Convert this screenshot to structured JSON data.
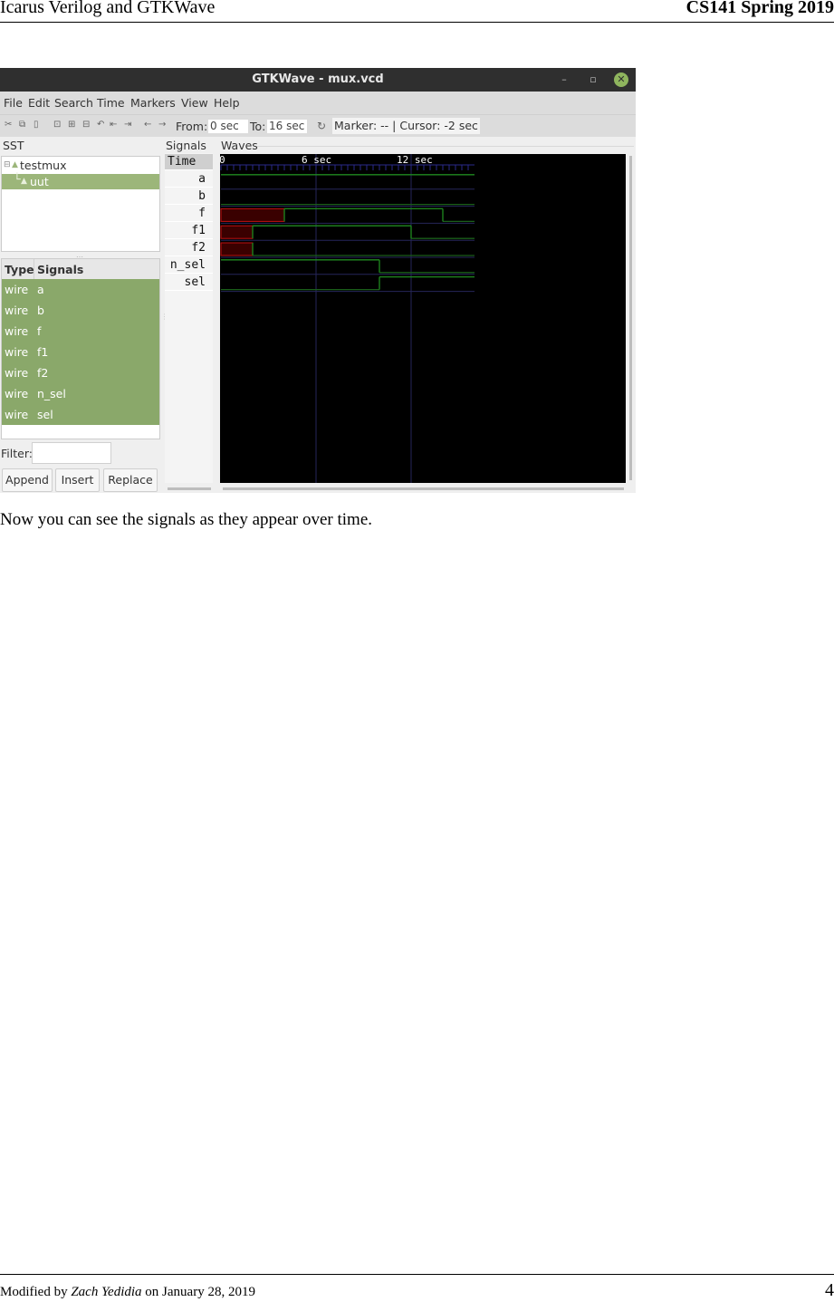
{
  "page": {
    "header_left": "Icarus Verilog and GTKWave",
    "header_right": "CS141 Spring 2019",
    "caption": "Now you can see the signals as they appear over time.",
    "footer_prefix": "Modified by ",
    "footer_author": "Zach Yedidia",
    "footer_suffix": " on January 28, 2019",
    "page_number": "4"
  },
  "window": {
    "title": "GTKWave - mux.vcd",
    "controls": {
      "minimize": "–",
      "maximize": "▫",
      "close": "✕"
    },
    "menu": [
      "File",
      "Edit",
      "Search",
      "Time",
      "Markers",
      "View",
      "Help"
    ],
    "toolbar": {
      "icons": [
        "cut-icon",
        "copy-icon",
        "paste-icon",
        "zoom-fit-icon",
        "zoom-in-icon",
        "zoom-out-icon",
        "undo-zoom-icon",
        "zoom-start-icon",
        "zoom-end-icon",
        "prev-icon",
        "next-icon"
      ],
      "icon_glyphs": [
        "✂",
        "⧉",
        "▯",
        "⊡",
        "⊞",
        "⊟",
        "↶",
        "⇤",
        "⇥",
        "←",
        "→"
      ],
      "from_label": "From:",
      "from_value": "0 sec",
      "to_label": "To:",
      "to_value": "16 sec",
      "reload_glyph": "↻",
      "marker_status": "Marker: --  |  Cursor: -2 sec"
    },
    "sst": {
      "label": "SST",
      "tree": [
        {
          "label": "testmux",
          "expander": "⊟",
          "selected": false
        },
        {
          "label": "uut",
          "selected": true
        }
      ],
      "columns": [
        "Type",
        "Signals"
      ],
      "signals": [
        {
          "type": "wire",
          "name": "a"
        },
        {
          "type": "wire",
          "name": "b"
        },
        {
          "type": "wire",
          "name": "f"
        },
        {
          "type": "wire",
          "name": "f1"
        },
        {
          "type": "wire",
          "name": "f2"
        },
        {
          "type": "wire",
          "name": "n_sel"
        },
        {
          "type": "wire",
          "name": "sel"
        }
      ],
      "filter_label": "Filter:",
      "filter_value": "",
      "buttons": [
        "Append",
        "Insert",
        "Replace"
      ]
    },
    "signals_pane": {
      "label": "Signals",
      "names": [
        "Time",
        "a",
        "b",
        "f",
        "f1",
        "f2",
        "n_sel",
        "sel"
      ]
    },
    "waves_pane": {
      "label": "Waves",
      "time_range_sec": [
        0,
        16
      ],
      "visible_end_sec": 16,
      "tick_labels": [
        {
          "t": 0,
          "label": "0"
        },
        {
          "t": 6,
          "label": "6 sec"
        },
        {
          "t": 12,
          "label": "12 sec"
        }
      ],
      "colors": {
        "bg": "#000000",
        "grid": "#26265a",
        "high": "#1f8a1f",
        "low": "#1a5e1a",
        "x_fill": "#3a0000",
        "x_edge": "#c01010",
        "ruler": "#2a2a8a",
        "text": "#ffffff"
      },
      "traces": [
        {
          "name": "a",
          "segments": [
            {
              "from": 0,
              "to": 16,
              "value": "1"
            }
          ]
        },
        {
          "name": "b",
          "segments": [
            {
              "from": 0,
              "to": 16,
              "value": "0"
            }
          ]
        },
        {
          "name": "f",
          "segments": [
            {
              "from": 0,
              "to": 4,
              "value": "x"
            },
            {
              "from": 4,
              "to": 14,
              "value": "1"
            },
            {
              "from": 14,
              "to": 16,
              "value": "0"
            }
          ]
        },
        {
          "name": "f1",
          "segments": [
            {
              "from": 0,
              "to": 2,
              "value": "x"
            },
            {
              "from": 2,
              "to": 12,
              "value": "1"
            },
            {
              "from": 12,
              "to": 16,
              "value": "0"
            }
          ]
        },
        {
          "name": "f2",
          "segments": [
            {
              "from": 0,
              "to": 2,
              "value": "x"
            },
            {
              "from": 2,
              "to": 16,
              "value": "0"
            }
          ]
        },
        {
          "name": "n_sel",
          "segments": [
            {
              "from": 0,
              "to": 10,
              "value": "1"
            },
            {
              "from": 10,
              "to": 16,
              "value": "0"
            }
          ]
        },
        {
          "name": "sel",
          "segments": [
            {
              "from": 0,
              "to": 10,
              "value": "0"
            },
            {
              "from": 10,
              "to": 16,
              "value": "1"
            }
          ]
        }
      ]
    }
  }
}
